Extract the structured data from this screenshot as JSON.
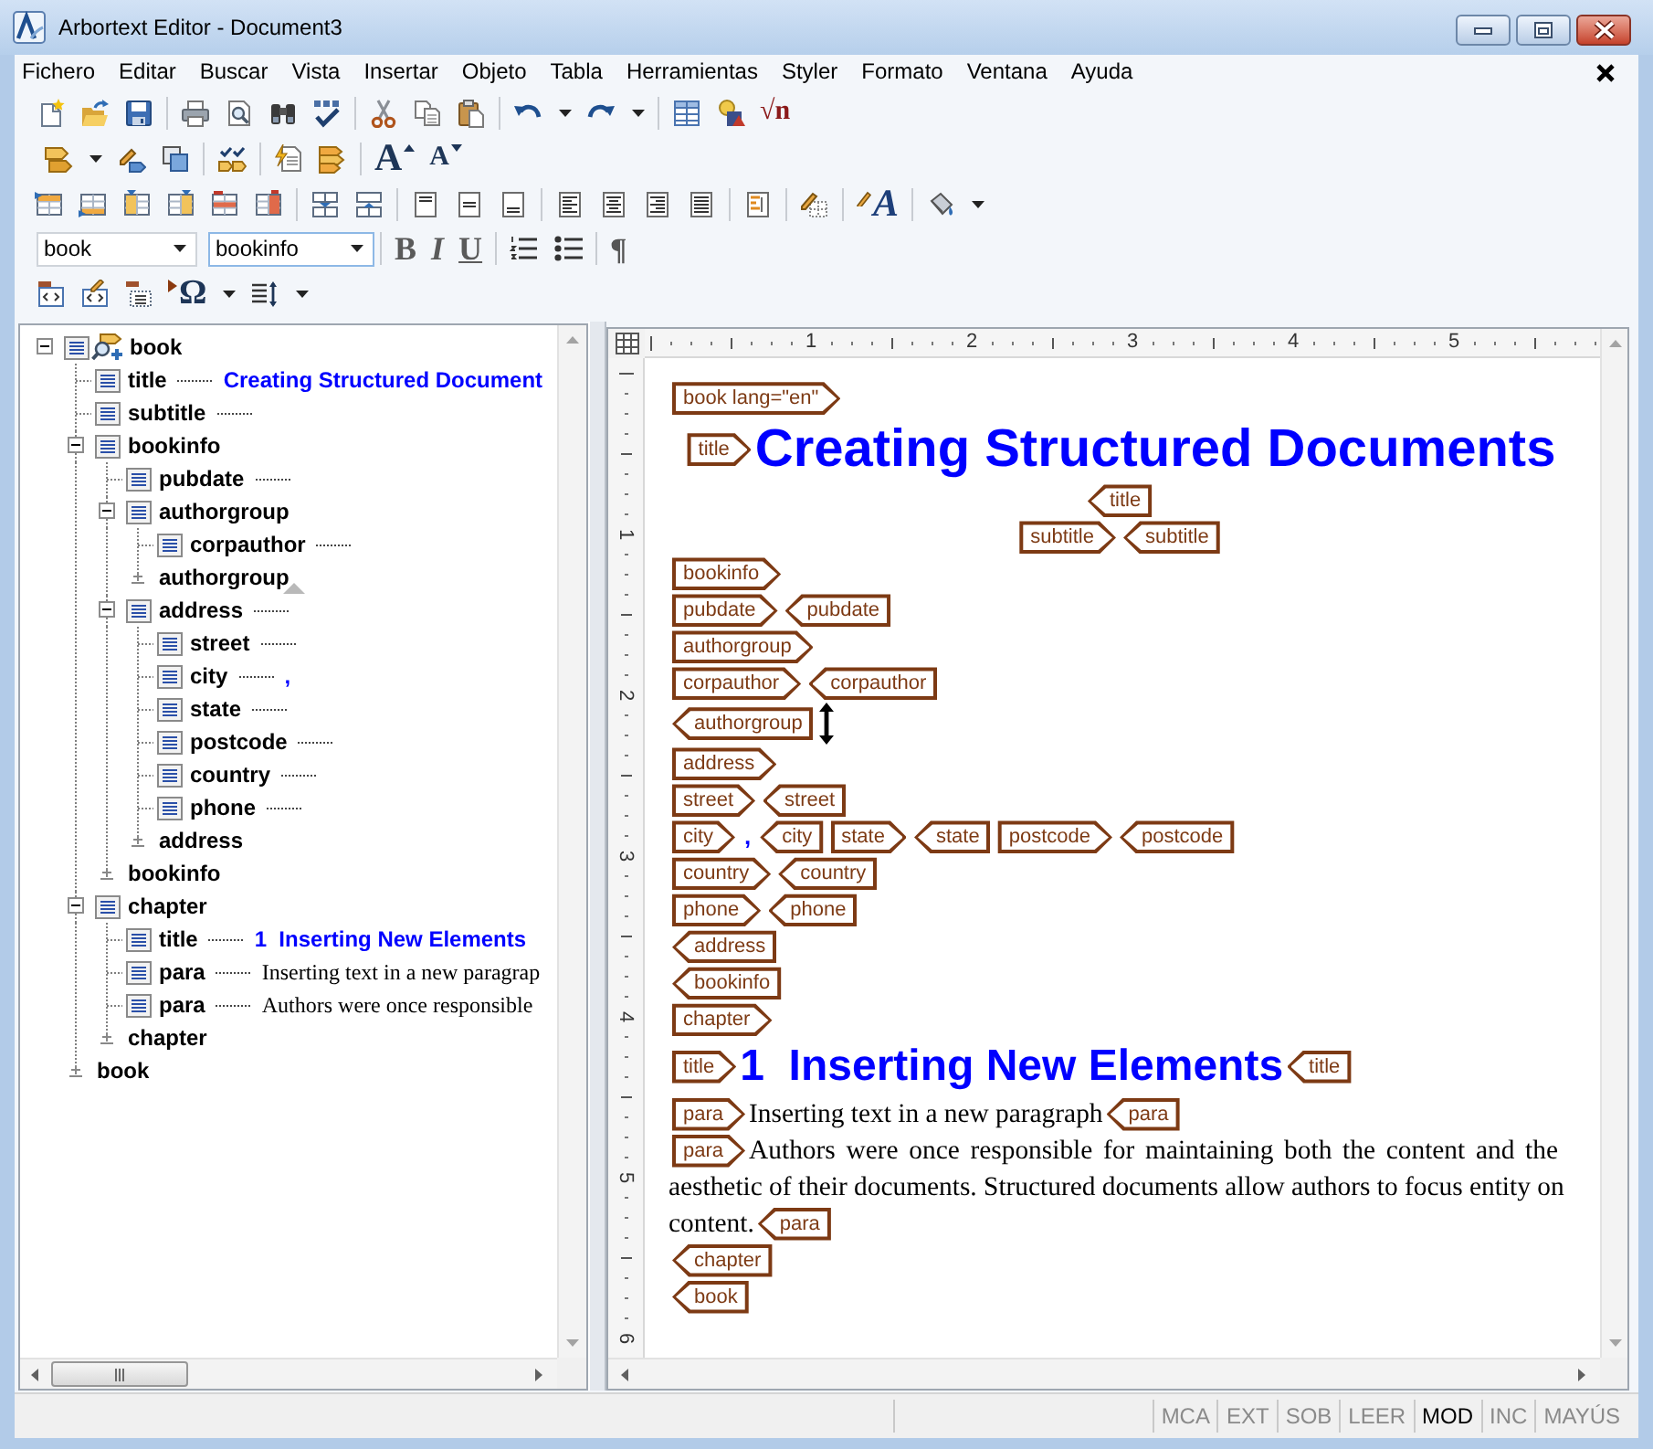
{
  "window": {
    "title": "Arbortext Editor - Document3"
  },
  "menu": [
    "Fichero",
    "Editar",
    "Buscar",
    "Vista",
    "Insertar",
    "Objeto",
    "Tabla",
    "Herramientas",
    "Styler",
    "Formato",
    "Ventana",
    "Ayuda"
  ],
  "toolbar": {
    "equation_button": "√n",
    "grow_font_button": "A",
    "shrink_font_button": "A",
    "text_style_button": "A",
    "element_dropdown": {
      "value": "book"
    },
    "context_dropdown": {
      "value": "bookinfo"
    },
    "bold_button": "B",
    "italic_button": "I",
    "underline_button": "U",
    "show_tags_button": "¶",
    "special_character_button": "Ω"
  },
  "tree": {
    "name": "book",
    "expanded": true,
    "dotted_leader": false,
    "children": [
      {
        "name": "title",
        "dotted_leader": true,
        "content": {
          "kind": "title",
          "text": "Creating Structured Document"
        }
      },
      {
        "name": "subtitle",
        "dotted_leader": true
      },
      {
        "name": "bookinfo",
        "expanded": true,
        "dotted_leader": false,
        "children": [
          {
            "name": "pubdate",
            "dotted_leader": true
          },
          {
            "name": "authorgroup",
            "expanded": true,
            "dotted_leader": false,
            "children": [
              {
                "name": "corpauthor",
                "dotted_leader": true
              }
            ],
            "end": {
              "label": "authorgroup",
              "insertion_point": true
            }
          },
          {
            "name": "address",
            "expanded": true,
            "dotted_leader": true,
            "children": [
              {
                "name": "street",
                "dotted_leader": true
              },
              {
                "name": "city",
                "dotted_leader": true,
                "content": {
                  "kind": "generated",
                  "text": ","
                }
              },
              {
                "name": "state",
                "dotted_leader": true
              },
              {
                "name": "postcode",
                "dotted_leader": true
              },
              {
                "name": "country",
                "dotted_leader": true
              },
              {
                "name": "phone",
                "dotted_leader": true
              }
            ],
            "end": {
              "label": "address",
              "insertion_point": false
            }
          }
        ],
        "end": {
          "label": "bookinfo",
          "insertion_point": false
        }
      },
      {
        "name": "chapter",
        "expanded": true,
        "dotted_leader": false,
        "children": [
          {
            "name": "title",
            "dotted_leader": true,
            "content": {
              "kind": "title",
              "text": "1  Inserting New Elements"
            }
          },
          {
            "name": "para",
            "dotted_leader": true,
            "content": {
              "kind": "para",
              "text": "Inserting text in a new paragrap"
            }
          },
          {
            "name": "para",
            "dotted_leader": true,
            "content": {
              "kind": "para",
              "text": "Authors were once responsible"
            }
          }
        ],
        "end": {
          "label": "chapter",
          "insertion_point": false
        }
      }
    ],
    "end": {
      "label": "book",
      "insertion_point": false
    }
  },
  "document": {
    "rulers": {
      "horizontal": [
        "1",
        "2",
        "3",
        "4",
        "5"
      ],
      "vertical": [
        "1",
        "2",
        "3",
        "4",
        "5",
        "6"
      ]
    },
    "blocks": [
      {
        "kind": "flush",
        "items": [
          {
            "kind": "start_tag",
            "label": "book lang=\"en\""
          }
        ]
      },
      {
        "kind": "centered",
        "items": [
          {
            "kind": "start_tag",
            "label": "title"
          },
          {
            "kind": "book_title",
            "text": "Creating Structured Documents"
          }
        ]
      },
      {
        "kind": "centered",
        "items": [
          {
            "kind": "end_tag",
            "label": "title"
          }
        ]
      },
      {
        "kind": "centered",
        "items": [
          {
            "kind": "start_tag",
            "label": "subtitle"
          },
          {
            "kind": "end_tag",
            "label": "subtitle"
          }
        ]
      },
      {
        "kind": "flush",
        "items": [
          {
            "kind": "start_tag",
            "label": "bookinfo"
          }
        ]
      },
      {
        "kind": "flush",
        "items": [
          {
            "kind": "start_tag",
            "label": "pubdate"
          },
          {
            "kind": "end_tag",
            "label": "pubdate"
          }
        ]
      },
      {
        "kind": "flush",
        "items": [
          {
            "kind": "start_tag",
            "label": "authorgroup"
          }
        ]
      },
      {
        "kind": "flush",
        "items": [
          {
            "kind": "start_tag",
            "label": "corpauthor"
          },
          {
            "kind": "end_tag",
            "label": "corpauthor"
          }
        ]
      },
      {
        "kind": "flush",
        "items": [
          {
            "kind": "end_tag",
            "label": "authorgroup"
          },
          {
            "kind": "mouse_pointer"
          }
        ]
      },
      {
        "kind": "flush",
        "items": [
          {
            "kind": "start_tag",
            "label": "address"
          }
        ]
      },
      {
        "kind": "flush",
        "items": [
          {
            "kind": "start_tag",
            "label": "street"
          },
          {
            "kind": "end_tag",
            "label": "street"
          }
        ]
      },
      {
        "kind": "flush",
        "items": [
          {
            "kind": "start_tag",
            "label": "city"
          },
          {
            "kind": "generated",
            "text": ","
          },
          {
            "kind": "end_tag",
            "label": "city"
          },
          {
            "kind": "start_tag",
            "label": "state"
          },
          {
            "kind": "end_tag",
            "label": "state"
          },
          {
            "kind": "start_tag",
            "label": "postcode"
          },
          {
            "kind": "end_tag",
            "label": "postcode"
          }
        ]
      },
      {
        "kind": "flush",
        "items": [
          {
            "kind": "start_tag",
            "label": "country"
          },
          {
            "kind": "end_tag",
            "label": "country"
          }
        ]
      },
      {
        "kind": "flush",
        "items": [
          {
            "kind": "start_tag",
            "label": "phone"
          },
          {
            "kind": "end_tag",
            "label": "phone"
          }
        ]
      },
      {
        "kind": "flush",
        "items": [
          {
            "kind": "end_tag",
            "label": "address"
          }
        ]
      },
      {
        "kind": "flush",
        "items": [
          {
            "kind": "end_tag",
            "label": "bookinfo"
          }
        ]
      },
      {
        "kind": "flush",
        "items": [
          {
            "kind": "start_tag",
            "label": "chapter"
          }
        ]
      },
      {
        "kind": "flush",
        "items": [
          {
            "kind": "start_tag",
            "label": "title"
          },
          {
            "kind": "chapter_title",
            "text": "1  Inserting New Elements"
          },
          {
            "kind": "end_tag",
            "label": "title"
          }
        ]
      },
      {
        "kind": "flush",
        "items": [
          {
            "kind": "start_tag",
            "label": "para"
          },
          {
            "kind": "text",
            "text": "Inserting text in a new paragraph"
          },
          {
            "kind": "end_tag",
            "label": "para"
          }
        ]
      },
      {
        "kind": "justified",
        "items": [
          {
            "kind": "start_tag",
            "label": "para"
          },
          {
            "kind": "text",
            "text": "Authors were once responsible for maintaining both the content and the"
          }
        ]
      },
      {
        "kind": "justified",
        "items": [
          {
            "kind": "text",
            "text": "aesthetic of their documents. Structured documents allow authors to focus entity on"
          }
        ]
      },
      {
        "kind": "flush",
        "items": [
          {
            "kind": "text",
            "text": "content."
          },
          {
            "kind": "end_tag",
            "label": "para"
          }
        ]
      },
      {
        "kind": "flush",
        "items": [
          {
            "kind": "end_tag",
            "label": "chapter"
          }
        ]
      },
      {
        "kind": "flush",
        "items": [
          {
            "kind": "end_tag",
            "label": "book"
          }
        ]
      }
    ]
  },
  "status_bar": {
    "indicators": [
      {
        "label": "MCA",
        "on": false
      },
      {
        "label": "EXT",
        "on": false
      },
      {
        "label": "SOB",
        "on": false
      },
      {
        "label": "LEER",
        "on": false
      },
      {
        "label": "MOD",
        "on": true
      },
      {
        "label": "INC",
        "on": false
      },
      {
        "label": "MAYÚS",
        "on": false
      }
    ]
  }
}
